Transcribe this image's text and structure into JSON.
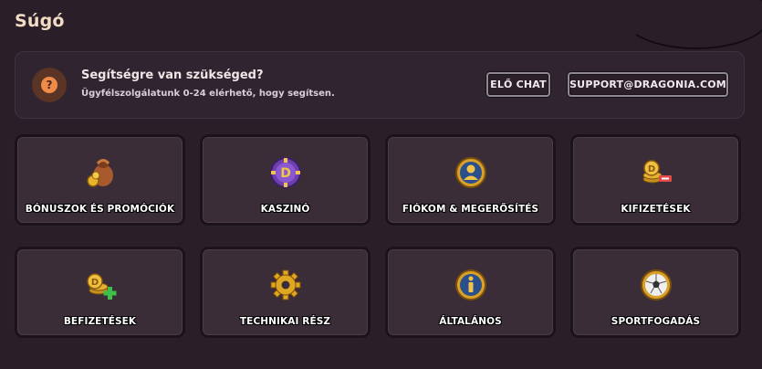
{
  "page": {
    "title": "Súgó"
  },
  "help": {
    "title": "Segítségre van szükséged?",
    "subtitle": "Ügyfélszolgálatunk 0-24 elérhető, hogy segítsen.",
    "icon": "question-icon",
    "chat_button": "ELŐ CHAT",
    "email_button": "SUPPORT@DRAGONIA.COM"
  },
  "categories": [
    {
      "label": "BÓNUSZOK ÉS PROMÓCIÓK",
      "icon": "money-bag-icon"
    },
    {
      "label": "KASZINÓ",
      "icon": "casino-chip-icon"
    },
    {
      "label": "FIÓKOM & MEGERŐSÍTÉS",
      "icon": "account-icon"
    },
    {
      "label": "KIFIZETÉSEK",
      "icon": "withdraw-coins-icon"
    },
    {
      "label": "BEFIZETÉSEK",
      "icon": "deposit-coins-icon"
    },
    {
      "label": "TECHNIKAI RÉSZ",
      "icon": "gear-icon"
    },
    {
      "label": "ÁLTALÁNOS",
      "icon": "info-icon"
    },
    {
      "label": "SPORTFOGADÁS",
      "icon": "soccer-ball-icon"
    }
  ]
}
